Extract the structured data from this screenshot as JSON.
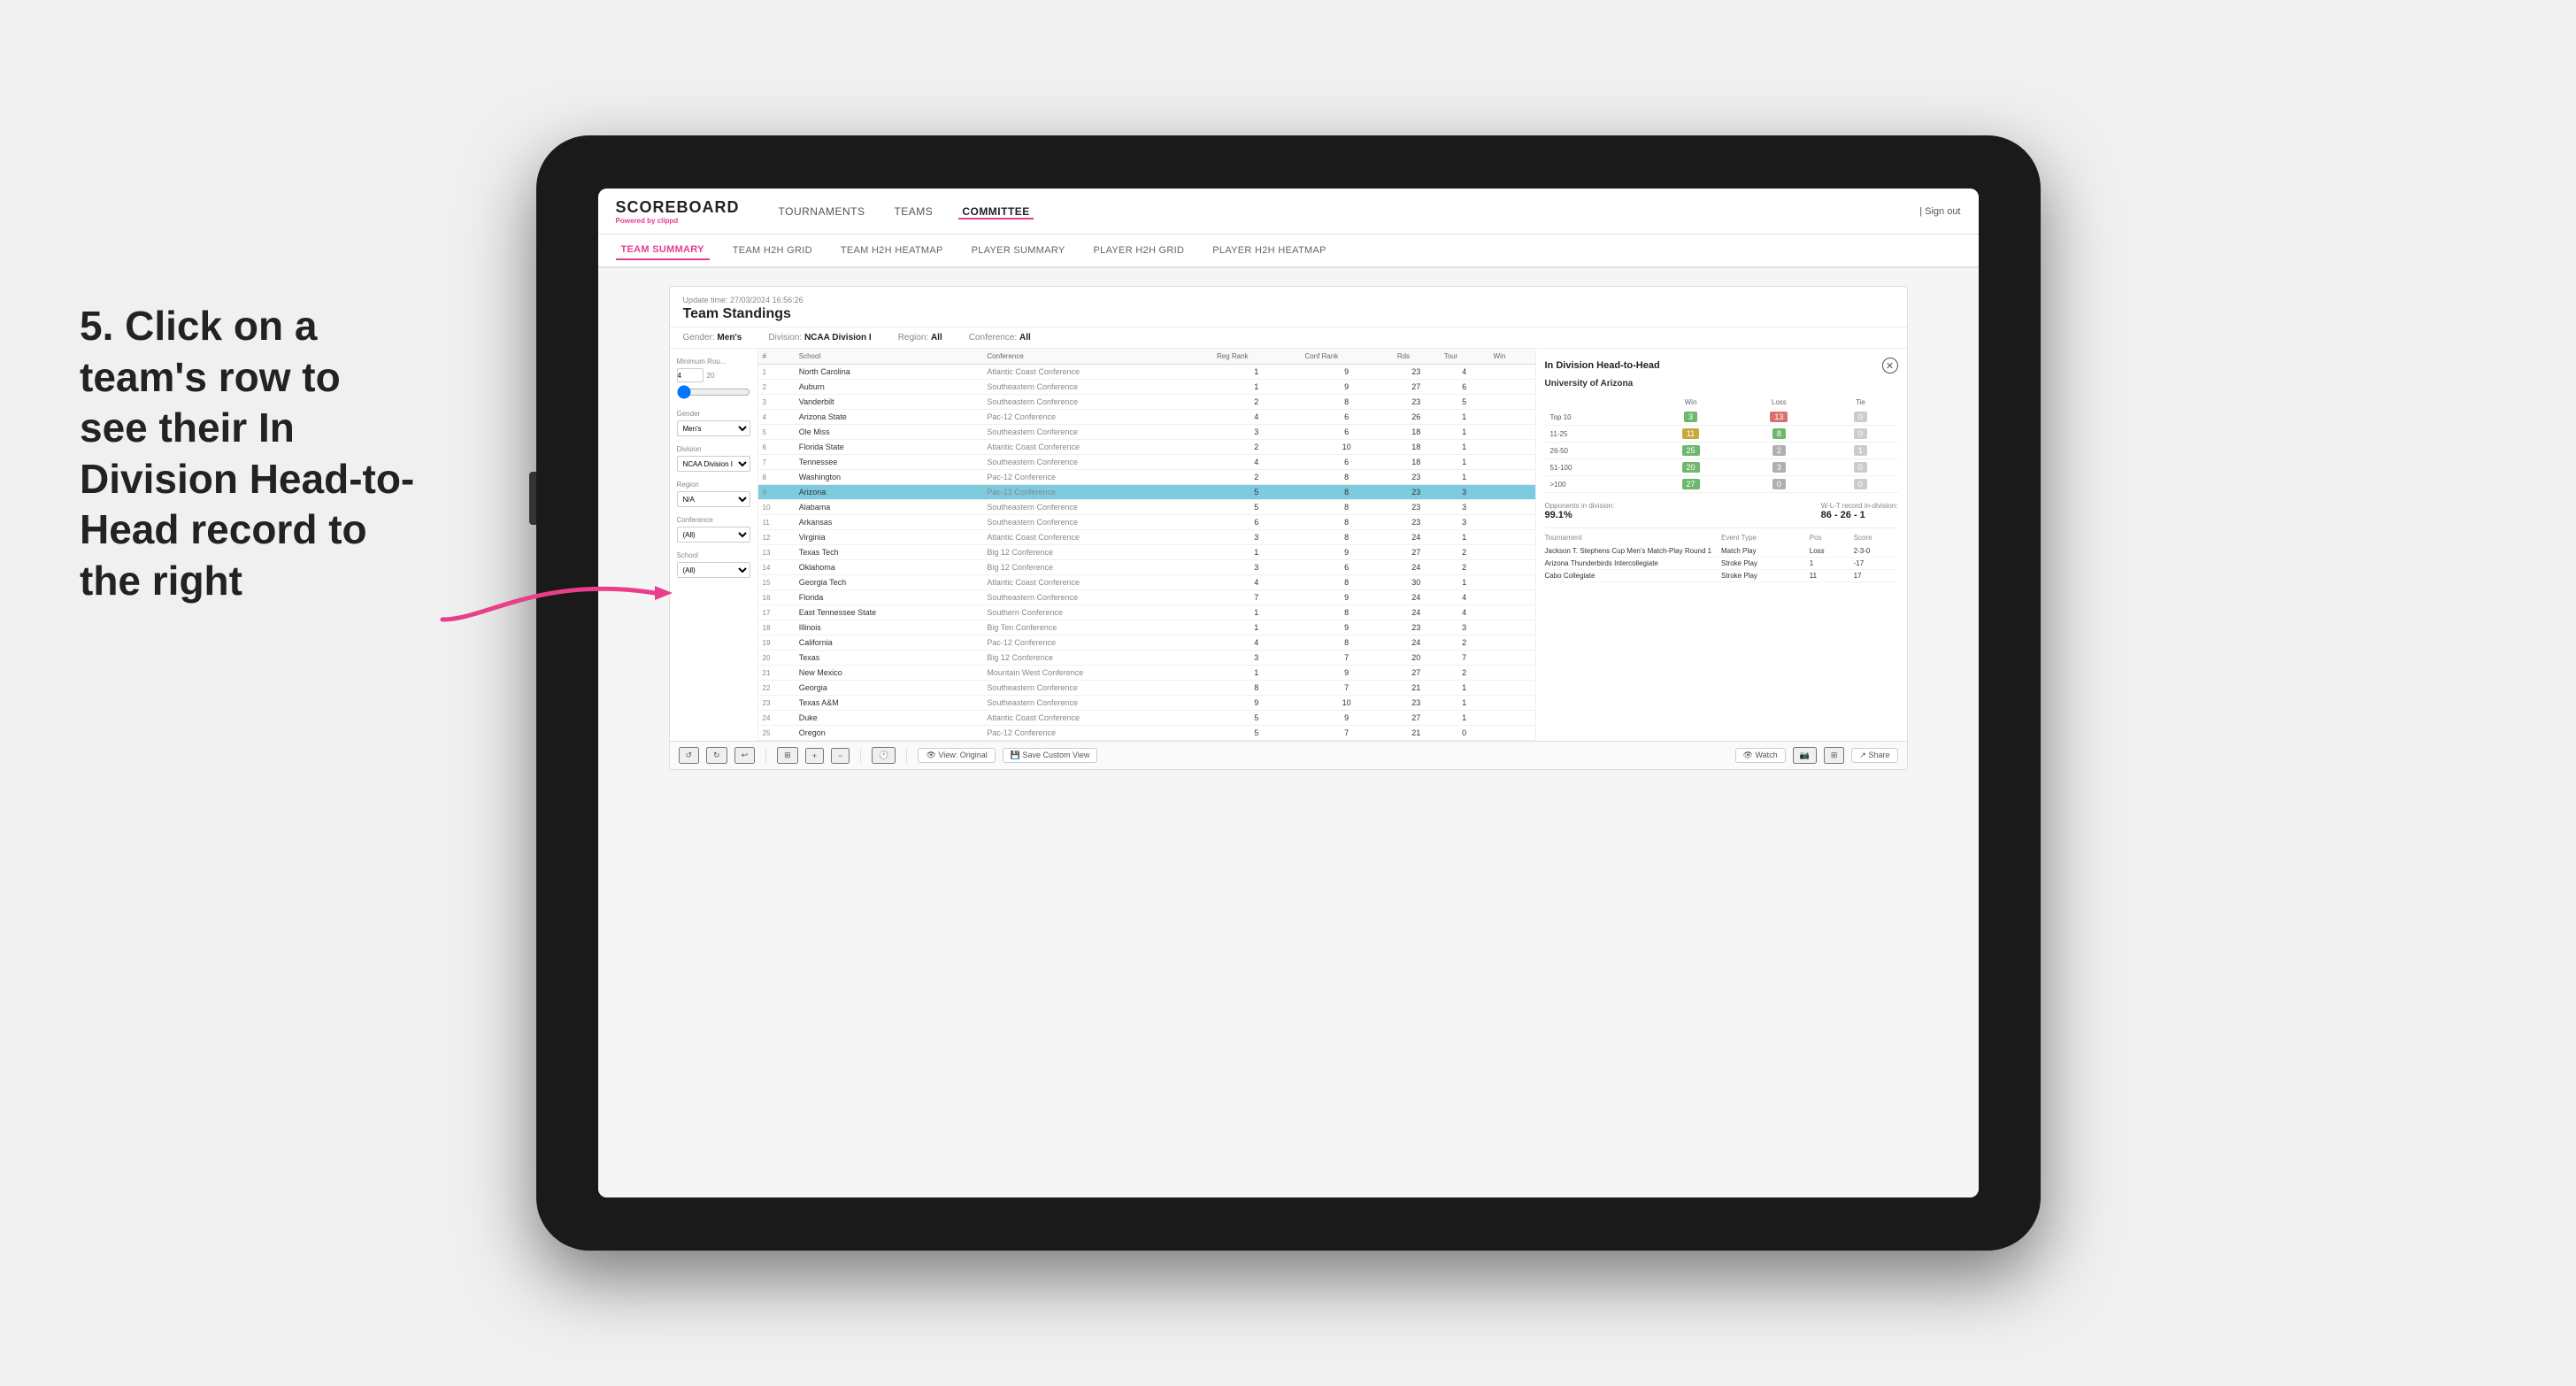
{
  "app": {
    "logo": "SCOREBOARD",
    "logo_sub": "Powered by",
    "logo_brand": "clippd",
    "sign_out": "Sign out"
  },
  "nav": {
    "items": [
      {
        "label": "TOURNAMENTS",
        "active": false
      },
      {
        "label": "TEAMS",
        "active": false
      },
      {
        "label": "COMMITTEE",
        "active": true
      }
    ]
  },
  "sub_nav": {
    "items": [
      {
        "label": "TEAM SUMMARY",
        "active": true
      },
      {
        "label": "TEAM H2H GRID",
        "active": false
      },
      {
        "label": "TEAM H2H HEATMAP",
        "active": false
      },
      {
        "label": "PLAYER SUMMARY",
        "active": false
      },
      {
        "label": "PLAYER H2H GRID",
        "active": false
      },
      {
        "label": "PLAYER H2H HEATMAP",
        "active": false
      }
    ]
  },
  "panel": {
    "update_time": "Update time: 27/03/2024 16:56:26",
    "title": "Team Standings",
    "gender_label": "Gender:",
    "gender_value": "Men's",
    "division_label": "Division:",
    "division_value": "NCAA Division I",
    "region_label": "Region:",
    "region_value": "All",
    "conference_label": "Conference:",
    "conference_value": "All"
  },
  "filters": {
    "min_rounds_label": "Minimum Rou...",
    "min_rounds_val": "4",
    "min_rounds_max": "20",
    "gender_label": "Gender",
    "gender_value": "Men's",
    "division_label": "Division",
    "division_value": "NCAA Division I",
    "region_label": "Region",
    "region_value": "N/A",
    "conference_label": "Conference",
    "conference_value": "(All)",
    "school_label": "School",
    "school_value": "(All)"
  },
  "table": {
    "headers": [
      "#",
      "School",
      "Conference",
      "Reg Rank",
      "Conf Rank",
      "Rds",
      "Tour",
      "Win"
    ],
    "rows": [
      {
        "rank": 1,
        "school": "North Carolina",
        "conference": "Atlantic Coast Conference",
        "reg_rank": 1,
        "conf_rank": 9,
        "rds": 23,
        "tour": 4,
        "win": ""
      },
      {
        "rank": 2,
        "school": "Auburn",
        "conference": "Southeastern Conference",
        "reg_rank": 1,
        "conf_rank": 9,
        "rds": 27,
        "tour": 6,
        "win": ""
      },
      {
        "rank": 3,
        "school": "Vanderbilt",
        "conference": "Southeastern Conference",
        "reg_rank": 2,
        "conf_rank": 8,
        "rds": 23,
        "tour": 5,
        "win": ""
      },
      {
        "rank": 4,
        "school": "Arizona State",
        "conference": "Pac-12 Conference",
        "reg_rank": 4,
        "conf_rank": 6,
        "rds": 26,
        "tour": 1,
        "win": ""
      },
      {
        "rank": 5,
        "school": "Ole Miss",
        "conference": "Southeastern Conference",
        "reg_rank": 3,
        "conf_rank": 6,
        "rds": 18,
        "tour": 1,
        "win": ""
      },
      {
        "rank": 6,
        "school": "Florida State",
        "conference": "Atlantic Coast Conference",
        "reg_rank": 2,
        "conf_rank": 10,
        "rds": 18,
        "tour": 1,
        "win": ""
      },
      {
        "rank": 7,
        "school": "Tennessee",
        "conference": "Southeastern Conference",
        "reg_rank": 4,
        "conf_rank": 6,
        "rds": 18,
        "tour": 1,
        "win": ""
      },
      {
        "rank": 8,
        "school": "Washington",
        "conference": "Pac-12 Conference",
        "reg_rank": 2,
        "conf_rank": 8,
        "rds": 23,
        "tour": 1,
        "win": ""
      },
      {
        "rank": 9,
        "school": "Arizona",
        "conference": "Pac-12 Conference",
        "reg_rank": 5,
        "conf_rank": 8,
        "rds": 23,
        "tour": 3,
        "win": "",
        "selected": true
      },
      {
        "rank": 10,
        "school": "Alabama",
        "conference": "Southeastern Conference",
        "reg_rank": 5,
        "conf_rank": 8,
        "rds": 23,
        "tour": 3,
        "win": ""
      },
      {
        "rank": 11,
        "school": "Arkansas",
        "conference": "Southeastern Conference",
        "reg_rank": 6,
        "conf_rank": 8,
        "rds": 23,
        "tour": 3,
        "win": ""
      },
      {
        "rank": 12,
        "school": "Virginia",
        "conference": "Atlantic Coast Conference",
        "reg_rank": 3,
        "conf_rank": 8,
        "rds": 24,
        "tour": 1,
        "win": ""
      },
      {
        "rank": 13,
        "school": "Texas Tech",
        "conference": "Big 12 Conference",
        "reg_rank": 1,
        "conf_rank": 9,
        "rds": 27,
        "tour": 2,
        "win": ""
      },
      {
        "rank": 14,
        "school": "Oklahoma",
        "conference": "Big 12 Conference",
        "reg_rank": 3,
        "conf_rank": 6,
        "rds": 24,
        "tour": 2,
        "win": ""
      },
      {
        "rank": 15,
        "school": "Georgia Tech",
        "conference": "Atlantic Coast Conference",
        "reg_rank": 4,
        "conf_rank": 8,
        "rds": 30,
        "tour": 1,
        "win": ""
      },
      {
        "rank": 16,
        "school": "Florida",
        "conference": "Southeastern Conference",
        "reg_rank": 7,
        "conf_rank": 9,
        "rds": 24,
        "tour": 4,
        "win": ""
      },
      {
        "rank": 17,
        "school": "East Tennessee State",
        "conference": "Southern Conference",
        "reg_rank": 1,
        "conf_rank": 8,
        "rds": 24,
        "tour": 4,
        "win": ""
      },
      {
        "rank": 18,
        "school": "Illinois",
        "conference": "Big Ten Conference",
        "reg_rank": 1,
        "conf_rank": 9,
        "rds": 23,
        "tour": 3,
        "win": ""
      },
      {
        "rank": 19,
        "school": "California",
        "conference": "Pac-12 Conference",
        "reg_rank": 4,
        "conf_rank": 8,
        "rds": 24,
        "tour": 2,
        "win": ""
      },
      {
        "rank": 20,
        "school": "Texas",
        "conference": "Big 12 Conference",
        "reg_rank": 3,
        "conf_rank": 7,
        "rds": 20,
        "tour": 7,
        "win": ""
      },
      {
        "rank": 21,
        "school": "New Mexico",
        "conference": "Mountain West Conference",
        "reg_rank": 1,
        "conf_rank": 9,
        "rds": 27,
        "tour": 2,
        "win": ""
      },
      {
        "rank": 22,
        "school": "Georgia",
        "conference": "Southeastern Conference",
        "reg_rank": 8,
        "conf_rank": 7,
        "rds": 21,
        "tour": 1,
        "win": ""
      },
      {
        "rank": 23,
        "school": "Texas A&M",
        "conference": "Southeastern Conference",
        "reg_rank": 9,
        "conf_rank": 10,
        "rds": 23,
        "tour": 1,
        "win": ""
      },
      {
        "rank": 24,
        "school": "Duke",
        "conference": "Atlantic Coast Conference",
        "reg_rank": 5,
        "conf_rank": 9,
        "rds": 27,
        "tour": 1,
        "win": ""
      },
      {
        "rank": 25,
        "school": "Oregon",
        "conference": "Pac-12 Conference",
        "reg_rank": 5,
        "conf_rank": 7,
        "rds": 21,
        "tour": 0,
        "win": ""
      }
    ]
  },
  "h2h": {
    "title": "In Division Head-to-Head",
    "school": "University of Arizona",
    "win_label": "Win",
    "loss_label": "Loss",
    "tie_label": "Tie",
    "rows": [
      {
        "range": "Top 10",
        "win": 3,
        "loss": 13,
        "tie": 0,
        "win_color": "green",
        "loss_color": "red"
      },
      {
        "range": "11-25",
        "win": 11,
        "loss": 8,
        "tie": 0,
        "win_color": "yellow",
        "loss_color": "green"
      },
      {
        "range": "26-50",
        "win": 25,
        "loss": 2,
        "tie": 1,
        "win_color": "green",
        "loss_color": "gray"
      },
      {
        "range": "51-100",
        "win": 20,
        "loss": 3,
        "tie": 0,
        "win_color": "green",
        "loss_color": "gray"
      },
      {
        "range": ">100",
        "win": 27,
        "loss": 0,
        "tie": 0,
        "win_color": "green",
        "loss_color": "gray"
      }
    ],
    "opp_label": "Opponents in division:",
    "opp_value": "99.1%",
    "wlt_label": "W-L-T record in-division:",
    "wlt_value": "86 - 26 - 1",
    "tournament_label": "Tournament",
    "event_type_label": "Event Type",
    "pos_label": "Pos",
    "score_label": "Score",
    "tournaments": [
      {
        "name": "Jackson T. Stephens Cup Men's Match-Play Round 1",
        "event_type": "Match Play",
        "result": "Loss",
        "score": "2-3-0"
      },
      {
        "name": "Arizona Thunderbirds Intercollegiate",
        "event_type": "Stroke Play",
        "result": "1",
        "score": "-17"
      },
      {
        "name": "Cabo Collegiate",
        "event_type": "Stroke Play",
        "result": "11",
        "score": "17"
      }
    ]
  },
  "toolbar": {
    "undo": "↺",
    "redo": "↻",
    "view_original": "View: Original",
    "save_custom": "Save Custom View",
    "watch": "Watch",
    "share": "Share"
  },
  "instruction": {
    "text": "5. Click on a team's row to see their In Division Head-to-Head record to the right"
  }
}
